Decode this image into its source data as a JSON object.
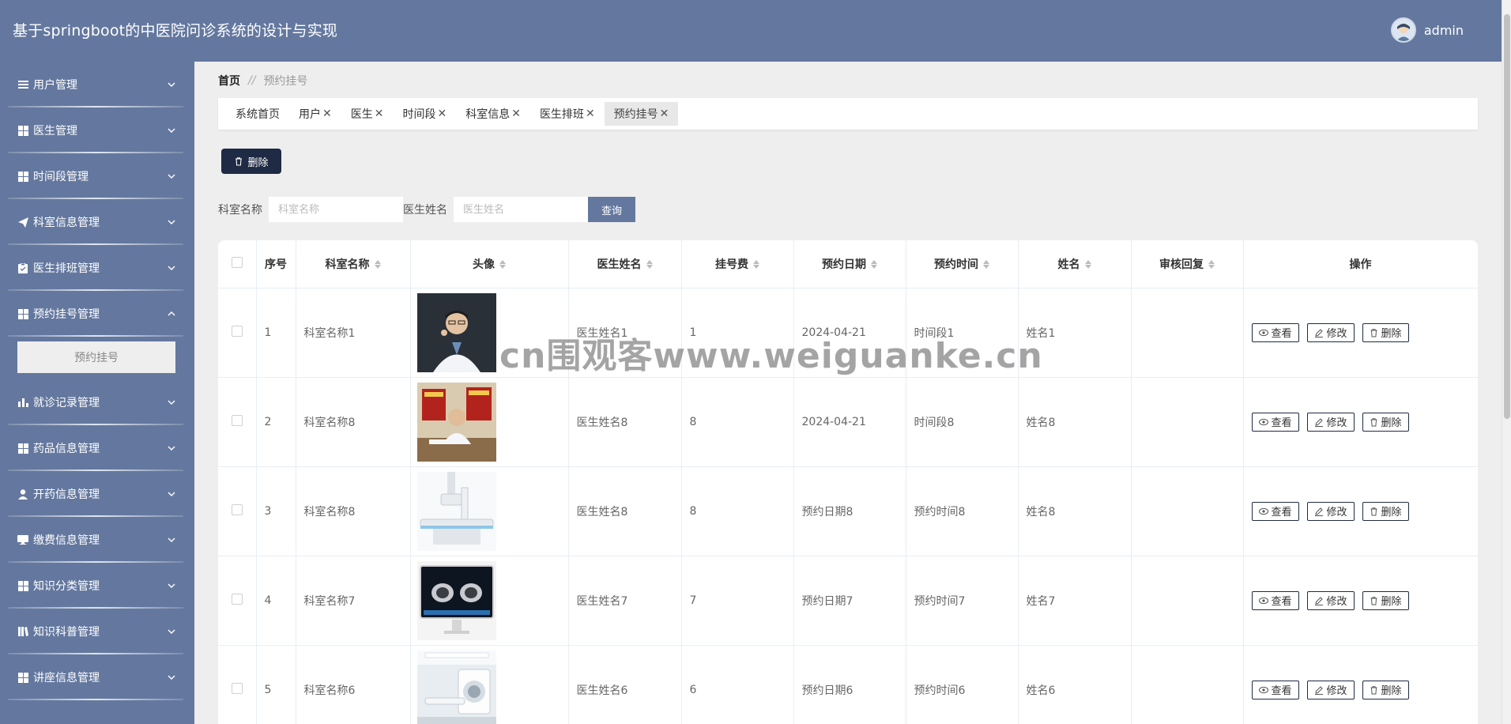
{
  "app": {
    "title": "基于springboot的中医院问诊系统的设计与实现"
  },
  "user": {
    "name": "admin"
  },
  "colors": {
    "primary": "#64789f",
    "dark_button": "#1f2a44"
  },
  "sidebar": {
    "items": [
      {
        "label": "用户管理",
        "icon": "list-icon"
      },
      {
        "label": "医生管理",
        "icon": "grid-icon"
      },
      {
        "label": "时间段管理",
        "icon": "grid-icon"
      },
      {
        "label": "科室信息管理",
        "icon": "paper-plane-icon"
      },
      {
        "label": "医生排班管理",
        "icon": "clipboard-icon"
      },
      {
        "label": "预约挂号管理",
        "icon": "grid-icon",
        "expanded": true,
        "children": [
          {
            "label": "预约挂号"
          }
        ]
      },
      {
        "label": "就诊记录管理",
        "icon": "bar-chart-icon"
      },
      {
        "label": "药品信息管理",
        "icon": "grid-icon"
      },
      {
        "label": "开药信息管理",
        "icon": "person-icon"
      },
      {
        "label": "缴费信息管理",
        "icon": "monitor-icon"
      },
      {
        "label": "知识分类管理",
        "icon": "grid-icon"
      },
      {
        "label": "知识科普管理",
        "icon": "book-icon"
      },
      {
        "label": "讲座信息管理",
        "icon": "grid-icon"
      }
    ]
  },
  "breadcrumb": {
    "home": "首页",
    "sep": "//",
    "current": "预约挂号"
  },
  "tabs": [
    {
      "label": "系统首页",
      "closable": false
    },
    {
      "label": "用户",
      "closable": true
    },
    {
      "label": "医生",
      "closable": true
    },
    {
      "label": "时间段",
      "closable": true
    },
    {
      "label": "科室信息",
      "closable": true
    },
    {
      "label": "医生排班",
      "closable": true
    },
    {
      "label": "预约挂号",
      "closable": true,
      "active": true
    }
  ],
  "toolbar": {
    "delete_label": "删除"
  },
  "search": {
    "dept_label": "科室名称",
    "dept_placeholder": "科室名称",
    "doctor_label": "医生姓名",
    "doctor_placeholder": "医生姓名",
    "query_label": "查询"
  },
  "table": {
    "columns": [
      "序号",
      "科室名称",
      "头像",
      "医生姓名",
      "挂号费",
      "预约日期",
      "预约时间",
      "姓名",
      "审核回复",
      "操作"
    ],
    "rows": [
      {
        "no": "1",
        "dept": "科室名称1",
        "doctor": "医生姓名1",
        "fee": "1",
        "date": "2024-04-21",
        "time": "时间段1",
        "name": "姓名1",
        "reply": "",
        "image": "doctor-portrait"
      },
      {
        "no": "2",
        "dept": "科室名称8",
        "doctor": "医生姓名8",
        "fee": "8",
        "date": "2024-04-21",
        "time": "时间段8",
        "name": "姓名8",
        "reply": "",
        "image": "doctor-office"
      },
      {
        "no": "3",
        "dept": "科室名称8",
        "doctor": "医生姓名8",
        "fee": "8",
        "date": "预约日期8",
        "time": "预约时间8",
        "name": "姓名8",
        "reply": "",
        "image": "xray-machine"
      },
      {
        "no": "4",
        "dept": "科室名称7",
        "doctor": "医生姓名7",
        "fee": "7",
        "date": "预约日期7",
        "time": "预约时间7",
        "name": "姓名7",
        "reply": "",
        "image": "ct-monitor"
      },
      {
        "no": "5",
        "dept": "科室名称6",
        "doctor": "医生姓名6",
        "fee": "6",
        "date": "预约日期6",
        "time": "预约时间6",
        "name": "姓名6",
        "reply": "",
        "image": "mri-room"
      }
    ],
    "actions": {
      "view": "查看",
      "edit": "修改",
      "delete": "删除"
    }
  },
  "watermark": "cn围观客www.weiguanke.cn"
}
